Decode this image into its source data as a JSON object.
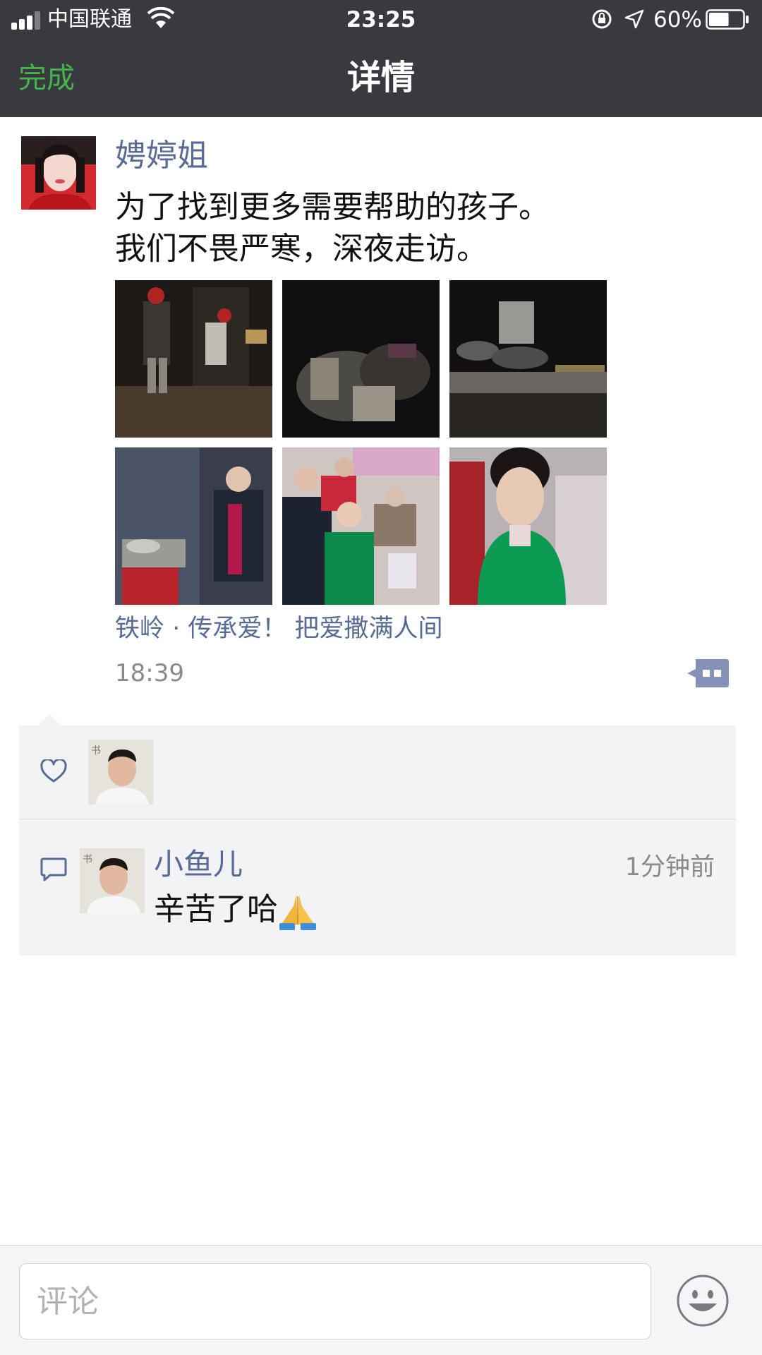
{
  "status_bar": {
    "carrier": "中国联通",
    "time": "23:25",
    "battery_percent": "60%",
    "battery_level": 0.6,
    "icons": [
      "signal-icon",
      "wifi-icon",
      "rotation-lock-icon",
      "location-icon",
      "battery-icon"
    ]
  },
  "nav": {
    "done_label": "完成",
    "title": "详情"
  },
  "colors": {
    "nav_background": "#393a3f",
    "done_green": "#44b549",
    "link_blue": "#576b95",
    "interaction_background": "#f3f3f5"
  },
  "post": {
    "author": "娉婷姐",
    "text_lines": [
      "为了找到更多需要帮助的孩子。",
      "我们不畏严寒，深夜走访。"
    ],
    "photo_count": 6,
    "location": "铁岭 · 传承爱！ 把爱撒满人间",
    "time": "18:39"
  },
  "likes": {
    "icon": "heart-icon"
  },
  "comments": [
    {
      "author": "小鱼儿",
      "time": "1分钟前",
      "text": "辛苦了哈",
      "emoji": "🙏"
    }
  ],
  "input": {
    "placeholder": "评论",
    "emoji_button_icon": "smiley-face-icon"
  }
}
